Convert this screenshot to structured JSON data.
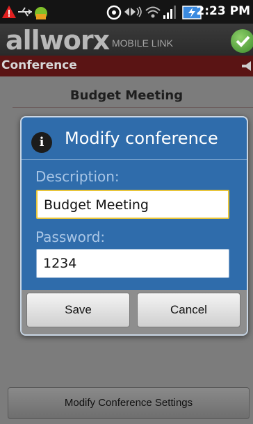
{
  "status_bar": {
    "time": "2:23 PM",
    "icons": [
      "warning-icon",
      "usb-icon",
      "android-icon",
      "sync-icon",
      "audio-icon",
      "wifi-icon",
      "signal-icon",
      "battery-icon"
    ]
  },
  "app_header": {
    "brand": "allworx",
    "subtitle": "MOBILE LINK"
  },
  "section": {
    "title": "Conference"
  },
  "conference": {
    "name": "Budget Meeting"
  },
  "dialog": {
    "title": "Modify conference",
    "description_label": "Description:",
    "description_value": "Budget Meeting",
    "password_label": "Password:",
    "password_value": "1234",
    "save_label": "Save",
    "cancel_label": "Cancel"
  },
  "bottom": {
    "button_label": "Modify Conference Settings"
  },
  "colors": {
    "dialog_bg": "#2f6cab",
    "section_bar": "#5a1414",
    "focus_border": "#e8c53a"
  }
}
